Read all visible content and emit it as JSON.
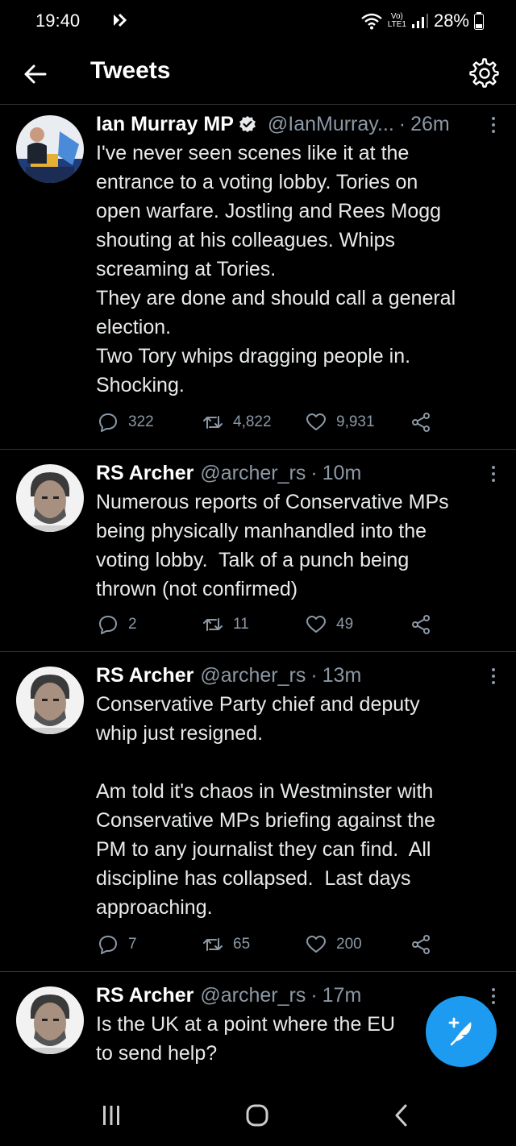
{
  "status_bar": {
    "time": "19:40",
    "network_label_top": "Vo)",
    "network_label_bottom": "LTE1",
    "battery": "28%"
  },
  "header": {
    "title": "Tweets"
  },
  "tweets": [
    {
      "author": "Ian Murray MP",
      "verified": true,
      "handle": "@IanMurray...",
      "time": "26m",
      "text": "I've never seen scenes like it at the\nentrance to a voting lobby. Tories on\nopen warfare. Jostling and Rees Mogg\nshouting at his colleagues. Whips\nscreaming at Tories.\nThey are done and should call a general\nelection.\nTwo Tory whips dragging people in.\nShocking.",
      "replies": "322",
      "retweets": "4,822",
      "likes": "9,931"
    },
    {
      "author": "RS Archer",
      "verified": false,
      "handle": "@archer_rs",
      "time": "10m",
      "text": "Numerous reports of Conservative MPs\nbeing physically manhandled into the\nvoting lobby.  Talk of a punch being\nthrown (not confirmed)",
      "replies": "2",
      "retweets": "11",
      "likes": "49"
    },
    {
      "author": "RS Archer",
      "verified": false,
      "handle": "@archer_rs",
      "time": "13m",
      "text": "Conservative Party chief and deputy\nwhip just resigned.\n\nAm told it's chaos in Westminster with\nConservative MPs briefing against the\nPM to any journalist they can find.  All\ndiscipline has collapsed.  Last days\napproaching.",
      "replies": "7",
      "retweets": "65",
      "likes": "200"
    },
    {
      "author": "RS Archer",
      "verified": false,
      "handle": "@archer_rs",
      "time": "17m",
      "text": "Is the UK at a point where the EU\nto send help?"
    }
  ],
  "colors": {
    "background": "#000000",
    "text": "#e7e9ea",
    "secondary": "#8b98a5",
    "accent": "#1d9bf0",
    "divider": "#2f3336"
  },
  "icons": {
    "back": "arrow-left-icon",
    "settings": "gear-icon",
    "reply": "speech-bubble-icon",
    "retweet": "retweet-icon",
    "like": "heart-icon",
    "share": "share-icon",
    "compose": "feather-plus-icon"
  }
}
